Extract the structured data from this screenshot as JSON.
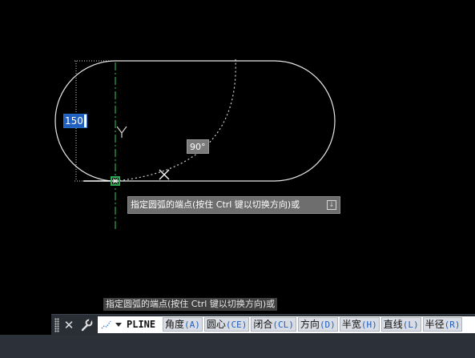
{
  "drawing": {
    "dimension_value": "150",
    "angle_value": "90°",
    "prompt_tooltip": "指定圆弧的端点(按住 Ctrl 键以切换方向)或",
    "colors": {
      "background": "#000000",
      "geometry": "#ffffff",
      "ucs_axis": "#2fa84f",
      "snap_marker": "#2fa84f",
      "dim_input_selection": "#1f5fbf"
    },
    "icons": [
      "ucs-y-axis-icon",
      "snap-marker-icon",
      "crosshair-cursor-icon",
      "tooltip-expand-icon"
    ]
  },
  "command_history": {
    "line": "指定圆弧的端点(按住 Ctrl 键以切换方向)或"
  },
  "command_line": {
    "command": "PLINE [",
    "options": [
      {
        "label": "角度",
        "key": "(A)"
      },
      {
        "label": "圆心",
        "key": "(CE)"
      },
      {
        "label": "闭合",
        "key": "(CL)"
      },
      {
        "label": "方向",
        "key": "(D)"
      },
      {
        "label": "半宽",
        "key": "(H)"
      },
      {
        "label": "直线",
        "key": "(L)"
      },
      {
        "label": "半径",
        "key": "(R)"
      }
    ],
    "icons": [
      "grip-icon",
      "close-icon",
      "wrench-icon",
      "recent-commands-icon",
      "chevron-down-icon"
    ]
  }
}
